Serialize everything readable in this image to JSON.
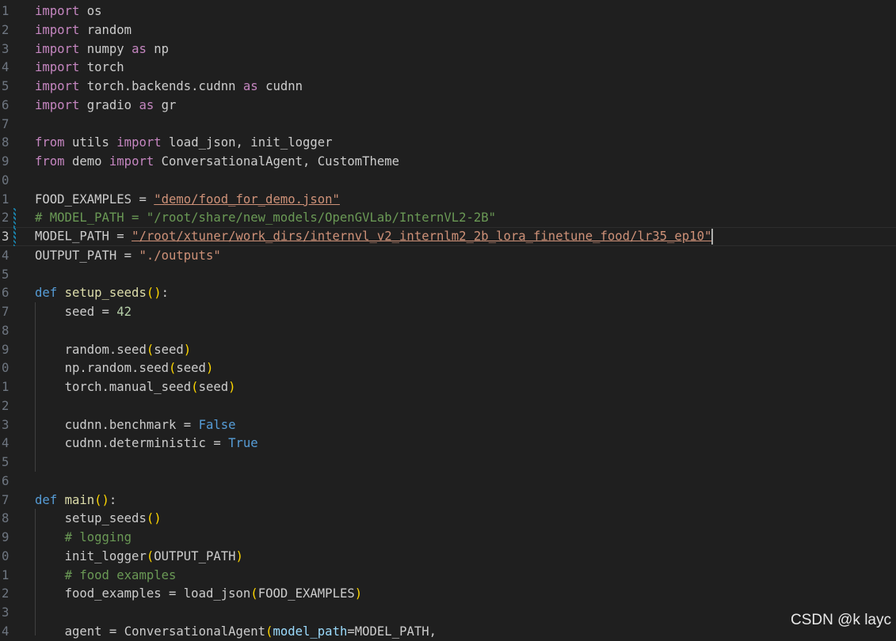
{
  "line_numbers": [
    "1",
    "2",
    "3",
    "4",
    "5",
    "6",
    "7",
    "8",
    "9",
    "0",
    "1",
    "2",
    "3",
    "4",
    "5",
    "6",
    "7",
    "8",
    "9",
    "0",
    "1",
    "2",
    "3",
    "4",
    "5",
    "6",
    "7",
    "8",
    "9",
    "0",
    "1",
    "2",
    "3",
    "4"
  ],
  "tokens": {
    "import": "import",
    "as": "as",
    "from": "from",
    "def": "def",
    "m_os": "os",
    "m_random": "random",
    "m_numpy": "numpy",
    "a_np": "np",
    "m_torch": "torch",
    "m_cudnn_path": "torch.backends.cudnn",
    "a_cudnn": "cudnn",
    "m_gradio": "gradio",
    "a_gr": "gr",
    "m_utils": "utils",
    "utils_names": "load_json, init_logger",
    "m_demo": "demo",
    "demo_names": "ConversationalAgent, CustomTheme",
    "food_examples_var": "FOOD_EXAMPLES",
    "eq": " = ",
    "food_examples_val": "\"demo/food_for_demo.json\"",
    "model_path_comment": "# MODEL_PATH = \"/root/share/new_models/OpenGVLab/InternVL2-2B\"",
    "model_path_var": "MODEL_PATH",
    "model_path_val": "\"/root/xtuner/work_dirs/internvl_v2_internlm2_2b_lora_finetune_food/lr35_ep10\"",
    "output_path_var": "OUTPUT_PATH",
    "output_path_val": "\"./outputs\"",
    "fn_setup_seeds": "setup_seeds",
    "seed_var": "seed",
    "seed_val": "42",
    "random_seed": "random.seed",
    "np_random_seed": "np.random.seed",
    "torch_manual_seed": "torch.manual_seed",
    "seed_arg": "seed",
    "benchmark_attr": "cudnn.benchmark",
    "false_kw": "False",
    "deterministic_attr": "cudnn.deterministic",
    "true_kw": "True",
    "fn_main": "main",
    "call_setup_seeds": "setup_seeds",
    "cmt_logging": "# logging",
    "init_logger": "init_logger",
    "output_path_arg": "OUTPUT_PATH",
    "cmt_food": "# food examples",
    "food_examples_local": "food_examples",
    "load_json": "load_json",
    "food_examples_arg": "FOOD_EXAMPLES",
    "agent_var": "agent",
    "conv_agent": "ConversationalAgent",
    "model_path_kw": "model_path",
    "model_path_arg": "MODEL_PATH,"
  },
  "colors": {
    "background": "#1f1f1f",
    "keyword_control": "#c586c0",
    "keyword": "#569cd6",
    "function": "#dcdcaa",
    "string": "#ce9178",
    "comment": "#6a9955",
    "number": "#b5cea8"
  },
  "watermark": "CSDN @k layc"
}
